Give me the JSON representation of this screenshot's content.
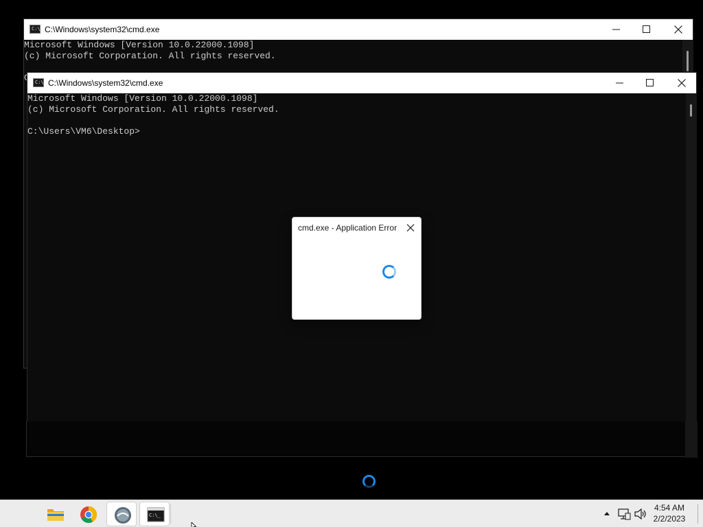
{
  "windows": {
    "back": {
      "title": "C:\\Windows\\system32\\cmd.exe",
      "icon": "console-icon",
      "lines": [
        "Microsoft Windows [Version 10.0.22000.1098]",
        "(c) Microsoft Corporation. All rights reserved.",
        "",
        "C"
      ]
    },
    "front": {
      "title": "C:\\Windows\\system32\\cmd.exe",
      "icon": "console-icon",
      "lines": [
        "Microsoft Windows [Version 10.0.22000.1098]",
        "(c) Microsoft Corporation. All rights reserved.",
        "",
        "C:\\Users\\VM6\\Desktop>"
      ]
    }
  },
  "dialog": {
    "title": "cmd.exe - Application Error",
    "close_icon": "close-icon",
    "busy_icon": "loading-spinner-icon"
  },
  "desktop_spinner_icon": "loading-spinner-icon",
  "taskbar": {
    "apps": [
      {
        "name": "File Explorer",
        "icon": "folder-icon"
      },
      {
        "name": "Google Chrome",
        "icon": "chrome-icon"
      },
      {
        "name": "Application",
        "icon": "app-icon"
      },
      {
        "name": "Command Prompt",
        "icon": "console-icon"
      }
    ],
    "tray": {
      "overflow_icon": "chevron-up-icon",
      "network_icon": "network-icon",
      "volume_icon": "speaker-icon",
      "time": "4:54 AM",
      "date": "2/2/2023"
    }
  },
  "colors": {
    "console_bg": "#0c0c0c",
    "console_text": "#cccccc",
    "spinner_accent": "#1e88e5",
    "taskbar_bg": "#ececec"
  }
}
